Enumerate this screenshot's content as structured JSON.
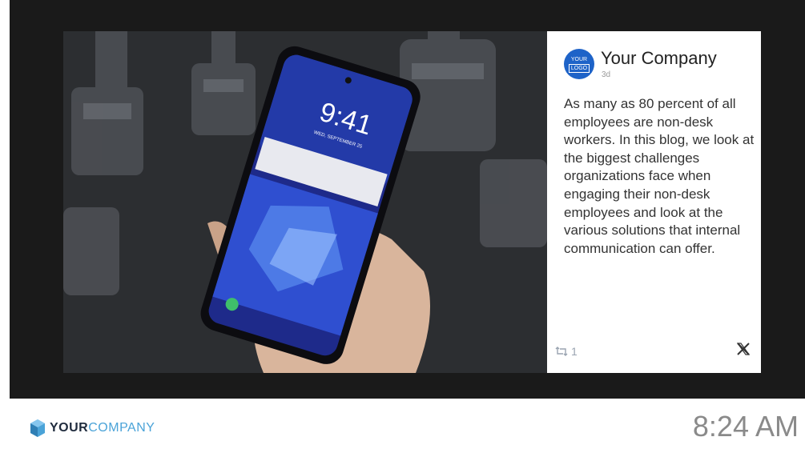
{
  "post": {
    "avatar_line1": "YOUR",
    "avatar_line2": "LOGO",
    "company_name": "Your Company",
    "time_ago": "3d",
    "body": "As many as 80 percent of all employees are non-desk workers. In this blog, we look at the biggest challenges organizations face when engaging their non-desk employees and look at the various solutions that internal communication can offer.",
    "retweet_count": "1"
  },
  "phone": {
    "time": "9:41",
    "date": "WED, SEPTEMBER 25"
  },
  "footer": {
    "brand_part1": "YOUR",
    "brand_part2": "COMPANY",
    "clock": "8:24 AM"
  },
  "icons": {
    "retweet": "retweet-icon",
    "x": "x-logo-icon",
    "brand": "brand-logo-icon"
  },
  "colors": {
    "screen_bg": "#1a1a1a",
    "avatar": "#1e63c8",
    "brand_dark": "#1f2b3d",
    "brand_light": "#4aa3d8"
  }
}
